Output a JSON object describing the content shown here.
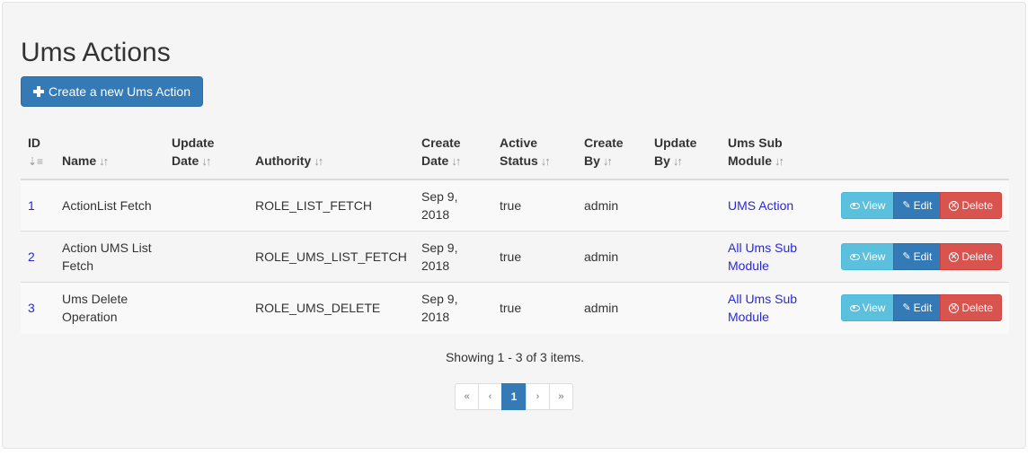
{
  "page": {
    "title": "Ums Actions",
    "create_button": "Create a new Ums Action"
  },
  "table": {
    "headers": {
      "id": "ID",
      "name": "Name",
      "update_date_1": "Update",
      "update_date_2": "Date",
      "authority": "Authority",
      "create_date_1": "Create",
      "create_date_2": "Date",
      "active_status_1": "Active",
      "active_status_2": "Status",
      "create_by_1": "Create",
      "create_by_2": "By",
      "update_by_1": "Update",
      "update_by_2": "By",
      "ums_sub_module_1": "Ums Sub",
      "ums_sub_module_2": "Module"
    },
    "rows": [
      {
        "id": "1",
        "name": "ActionList Fetch",
        "update_date": "",
        "authority": "ROLE_LIST_FETCH",
        "create_date": "Sep 9, 2018",
        "active_status": "true",
        "create_by": "admin",
        "update_by": "",
        "ums_sub_module": "UMS Action"
      },
      {
        "id": "2",
        "name": "Action UMS List Fetch",
        "update_date": "",
        "authority": "ROLE_UMS_LIST_FETCH",
        "create_date": "Sep 9, 2018",
        "active_status": "true",
        "create_by": "admin",
        "update_by": "",
        "ums_sub_module": "All Ums Sub Module"
      },
      {
        "id": "3",
        "name": "Ums Delete Operation",
        "update_date": "",
        "authority": "ROLE_UMS_DELETE",
        "create_date": "Sep 9, 2018",
        "active_status": "true",
        "create_by": "admin",
        "update_by": "",
        "ums_sub_module": "All Ums Sub Module"
      }
    ],
    "row_actions": {
      "view": "View",
      "edit": "Edit",
      "delete": "Delete"
    }
  },
  "summary": "Showing 1 - 3 of 3 items.",
  "pagination": {
    "first": "«",
    "prev": "‹",
    "current": "1",
    "next": "›",
    "last": "»"
  },
  "colors": {
    "primary": "#337ab7",
    "info": "#5bc0de",
    "danger": "#d9534f",
    "link": "#2a27e0"
  },
  "icons": {
    "create": "plus-icon",
    "sort": "sort-icon",
    "sort_active": "sort-numeric-asc-icon",
    "view": "eye-icon",
    "edit": "pencil-icon",
    "delete": "remove-circle-icon"
  }
}
